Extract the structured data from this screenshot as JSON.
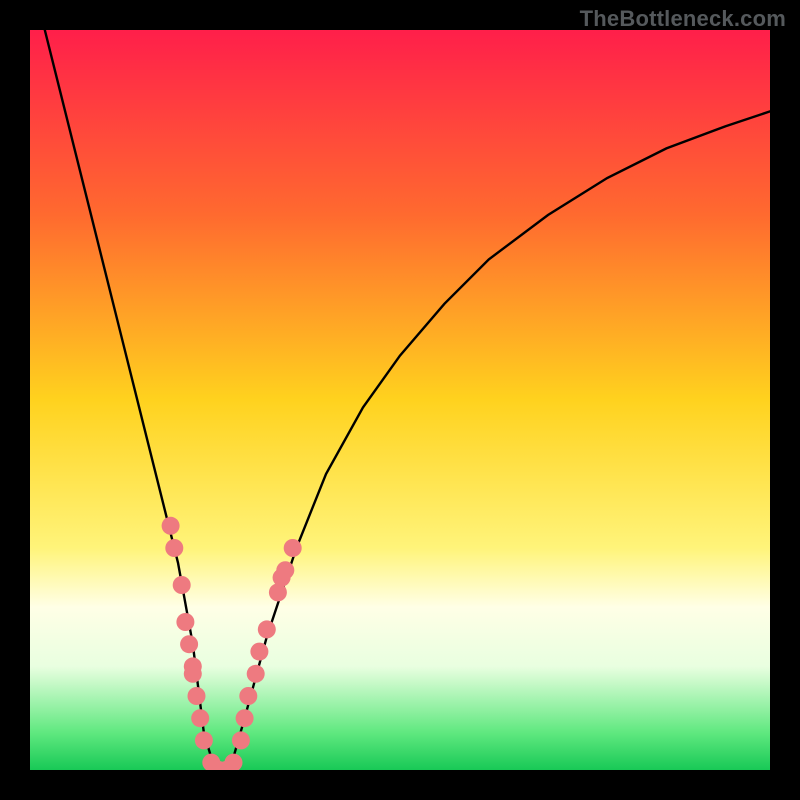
{
  "watermark": "TheBottleneck.com",
  "chart_data": {
    "type": "line",
    "title": "",
    "xlabel": "",
    "ylabel": "",
    "xlim": [
      0,
      100
    ],
    "ylim": [
      0,
      100
    ],
    "gradient_stops": [
      {
        "pct": 0,
        "color": "#ff1f4a"
      },
      {
        "pct": 25,
        "color": "#ff6a2f"
      },
      {
        "pct": 50,
        "color": "#ffd21e"
      },
      {
        "pct": 70,
        "color": "#fff47a"
      },
      {
        "pct": 78,
        "color": "#ffffe6"
      },
      {
        "pct": 86,
        "color": "#e9ffe0"
      },
      {
        "pct": 95,
        "color": "#5fe87f"
      },
      {
        "pct": 100,
        "color": "#18c956"
      }
    ],
    "series": [
      {
        "name": "bottleneck-curve",
        "color": "#000000",
        "x": [
          2,
          4,
          6,
          8,
          10,
          12,
          14,
          16,
          18,
          20,
          22,
          23.5,
          25,
          27,
          29,
          32,
          36,
          40,
          45,
          50,
          56,
          62,
          70,
          78,
          86,
          94,
          100
        ],
        "values": [
          100,
          92,
          84,
          76,
          68,
          60,
          52,
          44,
          36,
          28,
          17,
          5,
          0,
          0,
          7,
          18,
          30,
          40,
          49,
          56,
          63,
          69,
          75,
          80,
          84,
          87,
          89
        ]
      }
    ],
    "scatter": {
      "name": "markers",
      "color": "#ee7a80",
      "points": [
        {
          "x": 19.0,
          "y": 33
        },
        {
          "x": 19.5,
          "y": 30
        },
        {
          "x": 20.5,
          "y": 25
        },
        {
          "x": 21.0,
          "y": 20
        },
        {
          "x": 21.5,
          "y": 17
        },
        {
          "x": 22.0,
          "y": 14
        },
        {
          "x": 22.0,
          "y": 13
        },
        {
          "x": 22.5,
          "y": 10
        },
        {
          "x": 23.0,
          "y": 7
        },
        {
          "x": 23.5,
          "y": 4
        },
        {
          "x": 24.5,
          "y": 1
        },
        {
          "x": 25.5,
          "y": 0
        },
        {
          "x": 26.5,
          "y": 0
        },
        {
          "x": 27.5,
          "y": 1
        },
        {
          "x": 28.5,
          "y": 4
        },
        {
          "x": 29.0,
          "y": 7
        },
        {
          "x": 29.5,
          "y": 10
        },
        {
          "x": 30.5,
          "y": 13
        },
        {
          "x": 31.0,
          "y": 16
        },
        {
          "x": 32.0,
          "y": 19
        },
        {
          "x": 33.5,
          "y": 24
        },
        {
          "x": 34.0,
          "y": 26
        },
        {
          "x": 34.5,
          "y": 27
        },
        {
          "x": 35.5,
          "y": 30
        }
      ]
    },
    "annotations": []
  }
}
